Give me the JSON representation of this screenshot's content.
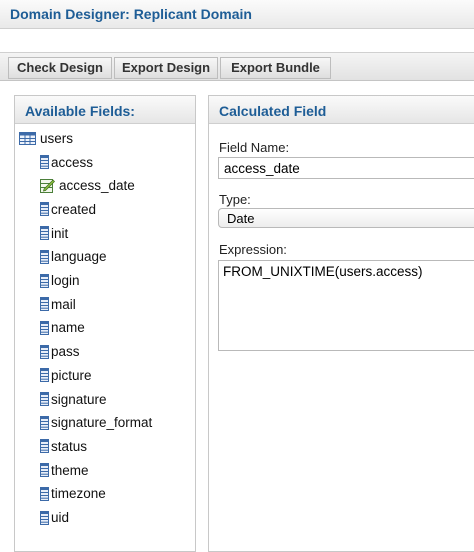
{
  "window": {
    "title": "Domain Designer: Replicant Domain"
  },
  "toolbar": {
    "check_design": "Check Design",
    "export_design": "Export Design",
    "export_bundle": "Export Bundle"
  },
  "fields_panel": {
    "title": "Available Fields:",
    "table": {
      "label": "users",
      "icon": "table-icon"
    },
    "items": [
      {
        "label": "access",
        "icon": "field-icon"
      },
      {
        "label": "access_date",
        "icon": "calculated-field-icon"
      },
      {
        "label": "created",
        "icon": "field-icon"
      },
      {
        "label": "init",
        "icon": "field-icon"
      },
      {
        "label": "language",
        "icon": "field-icon"
      },
      {
        "label": "login",
        "icon": "field-icon"
      },
      {
        "label": "mail",
        "icon": "field-icon"
      },
      {
        "label": "name",
        "icon": "field-icon"
      },
      {
        "label": "pass",
        "icon": "field-icon"
      },
      {
        "label": "picture",
        "icon": "field-icon"
      },
      {
        "label": "signature",
        "icon": "field-icon"
      },
      {
        "label": "signature_format",
        "icon": "field-icon"
      },
      {
        "label": "status",
        "icon": "field-icon"
      },
      {
        "label": "theme",
        "icon": "field-icon"
      },
      {
        "label": "timezone",
        "icon": "field-icon"
      },
      {
        "label": "uid",
        "icon": "field-icon"
      }
    ]
  },
  "calc_panel": {
    "title": "Calculated Field",
    "field_name_label": "Field Name:",
    "field_name_value": "access_date",
    "type_label": "Type:",
    "type_value": "Date",
    "expression_label": "Expression:",
    "expression_value": "FROM_UNIXTIME(users.access)"
  }
}
